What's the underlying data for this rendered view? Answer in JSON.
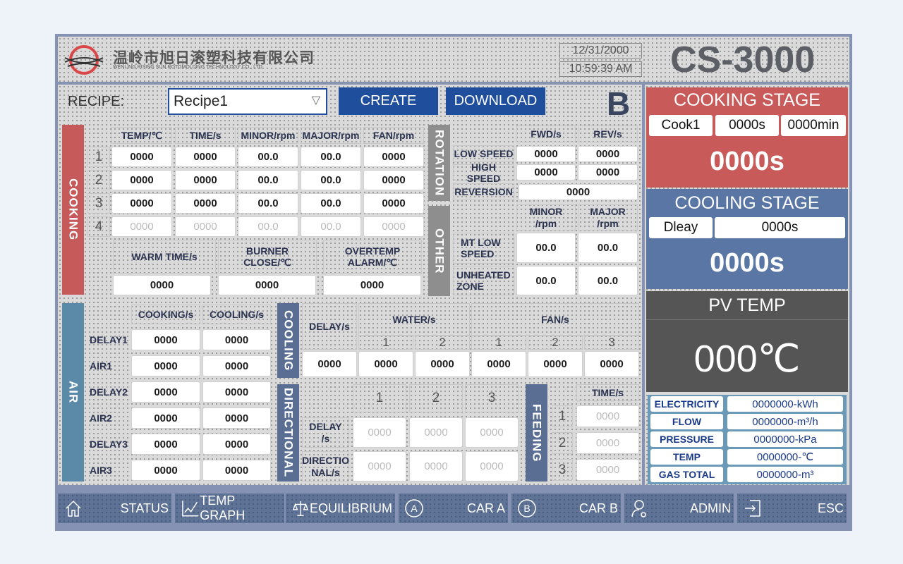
{
  "header": {
    "company_cn": "温岭市旭日滚塑科技有限公司",
    "company_en": "WENLING RISING SUN ROTOMOLDING TECHNOLOGY CO., LTD.",
    "date": "12/31/2000",
    "time": "10:59:39 AM",
    "model": "CS-3000"
  },
  "recipe": {
    "label": "RECIPE:",
    "selected": "Recipe1",
    "create": "CREATE",
    "download": "DOWNLOAD",
    "car": "B"
  },
  "cooking": {
    "title": "COOKING",
    "headers": [
      "TEMP/℃",
      "TIME/s",
      "MINOR/rpm",
      "MAJOR/rpm",
      "FAN/rpm"
    ],
    "rows": [
      {
        "n": "1",
        "v": [
          "0000",
          "0000",
          "00.0",
          "00.0",
          "0000"
        ]
      },
      {
        "n": "2",
        "v": [
          "0000",
          "0000",
          "00.0",
          "00.0",
          "0000"
        ]
      },
      {
        "n": "3",
        "v": [
          "0000",
          "0000",
          "00.0",
          "00.0",
          "0000"
        ]
      },
      {
        "n": "4",
        "v": [
          "0000",
          "0000",
          "00.0",
          "00.0",
          "0000"
        ]
      }
    ],
    "extra": [
      {
        "label": "WARM TIME/s",
        "value": "0000"
      },
      {
        "label": "BURNER CLOSE/℃",
        "value": "0000"
      },
      {
        "label": "OVERTEMP ALARM/℃",
        "value": "0000"
      }
    ]
  },
  "rotation": {
    "title": "ROTATION",
    "headers": [
      "FWD/s",
      "REV/s"
    ],
    "low_label": "LOW SPEED",
    "low": [
      "0000",
      "0000"
    ],
    "high_label": "HIGH SPEED",
    "high": [
      "0000",
      "0000"
    ],
    "rev_label": "REVERSION",
    "rev": "0000"
  },
  "other": {
    "title": "OTHER",
    "headers": [
      "MINOR /rpm",
      "MAJOR /rpm"
    ],
    "mt_label": "MT LOW SPEED",
    "mt": [
      "00.0",
      "00.0"
    ],
    "uz_label": "UNHEATED ZONE",
    "uz": [
      "00.0",
      "00.0"
    ]
  },
  "air": {
    "title": "AIR",
    "headers": [
      "COOKING/s",
      "COOLING/s"
    ],
    "rows": [
      {
        "label": "DELAY1",
        "v": [
          "0000",
          "0000"
        ]
      },
      {
        "label": "AIR1",
        "v": [
          "0000",
          "0000"
        ]
      },
      {
        "label": "DELAY2",
        "v": [
          "0000",
          "0000"
        ]
      },
      {
        "label": "AIR2",
        "v": [
          "0000",
          "0000"
        ]
      },
      {
        "label": "DELAY3",
        "v": [
          "0000",
          "0000"
        ]
      },
      {
        "label": "AIR3",
        "v": [
          "0000",
          "0000"
        ]
      }
    ]
  },
  "cooling": {
    "title": "COOLING",
    "delay": "DELAY/s",
    "water": "WATER/s",
    "fan": "FAN/s",
    "sub": [
      "1",
      "2",
      "1",
      "2",
      "3"
    ],
    "values": [
      "0000",
      "0000",
      "0000",
      "0000",
      "0000",
      "0000"
    ]
  },
  "directional": {
    "title": "DIRECTIONAL",
    "cols": [
      "1",
      "2",
      "3"
    ],
    "delay_label": "DELAY /s",
    "delay": [
      "0000",
      "0000",
      "0000"
    ],
    "dir_label": "DIRECTIO NAL/s",
    "dir": [
      "0000",
      "0000",
      "0000"
    ]
  },
  "feeding": {
    "title": "FEEDING",
    "header": "TIME/s",
    "rows": [
      {
        "n": "1",
        "v": "0000"
      },
      {
        "n": "2",
        "v": "0000"
      },
      {
        "n": "3",
        "v": "0000"
      }
    ]
  },
  "cooking_stage": {
    "title": "COOKING STAGE",
    "step": "Cook1",
    "time_s": "0000s",
    "time_min": "0000min",
    "remaining": "0000s",
    "color": "#c85a5a"
  },
  "cooling_stage": {
    "title": "COOLING STAGE",
    "step": "Dleay",
    "time_s": "0000s",
    "remaining": "0000s",
    "color": "#5a76a4"
  },
  "pv_temp": {
    "title": "PV TEMP",
    "value": "000℃"
  },
  "meters": [
    {
      "label": "ELECTRICITY",
      "value": "0000000-kWh"
    },
    {
      "label": "FLOW",
      "value": "0000000-m³/h"
    },
    {
      "label": "PRESSURE",
      "value": "0000000-kPa"
    },
    {
      "label": "TEMP",
      "value": "0000000-℃"
    },
    {
      "label": "GAS TOTAL",
      "value": "0000000-m³"
    }
  ],
  "nav": [
    {
      "label": "STATUS",
      "icon": "home-icon"
    },
    {
      "label": "TEMP GRAPH",
      "icon": "chart-icon"
    },
    {
      "label": "EQUILIBRIUM",
      "icon": "balance-icon"
    },
    {
      "label": "CAR A",
      "icon": "circle-a-icon"
    },
    {
      "label": "CAR B",
      "icon": "circle-b-icon"
    },
    {
      "label": "ADMIN",
      "icon": "user-key-icon"
    },
    {
      "label": "ESC",
      "icon": "exit-icon"
    }
  ]
}
